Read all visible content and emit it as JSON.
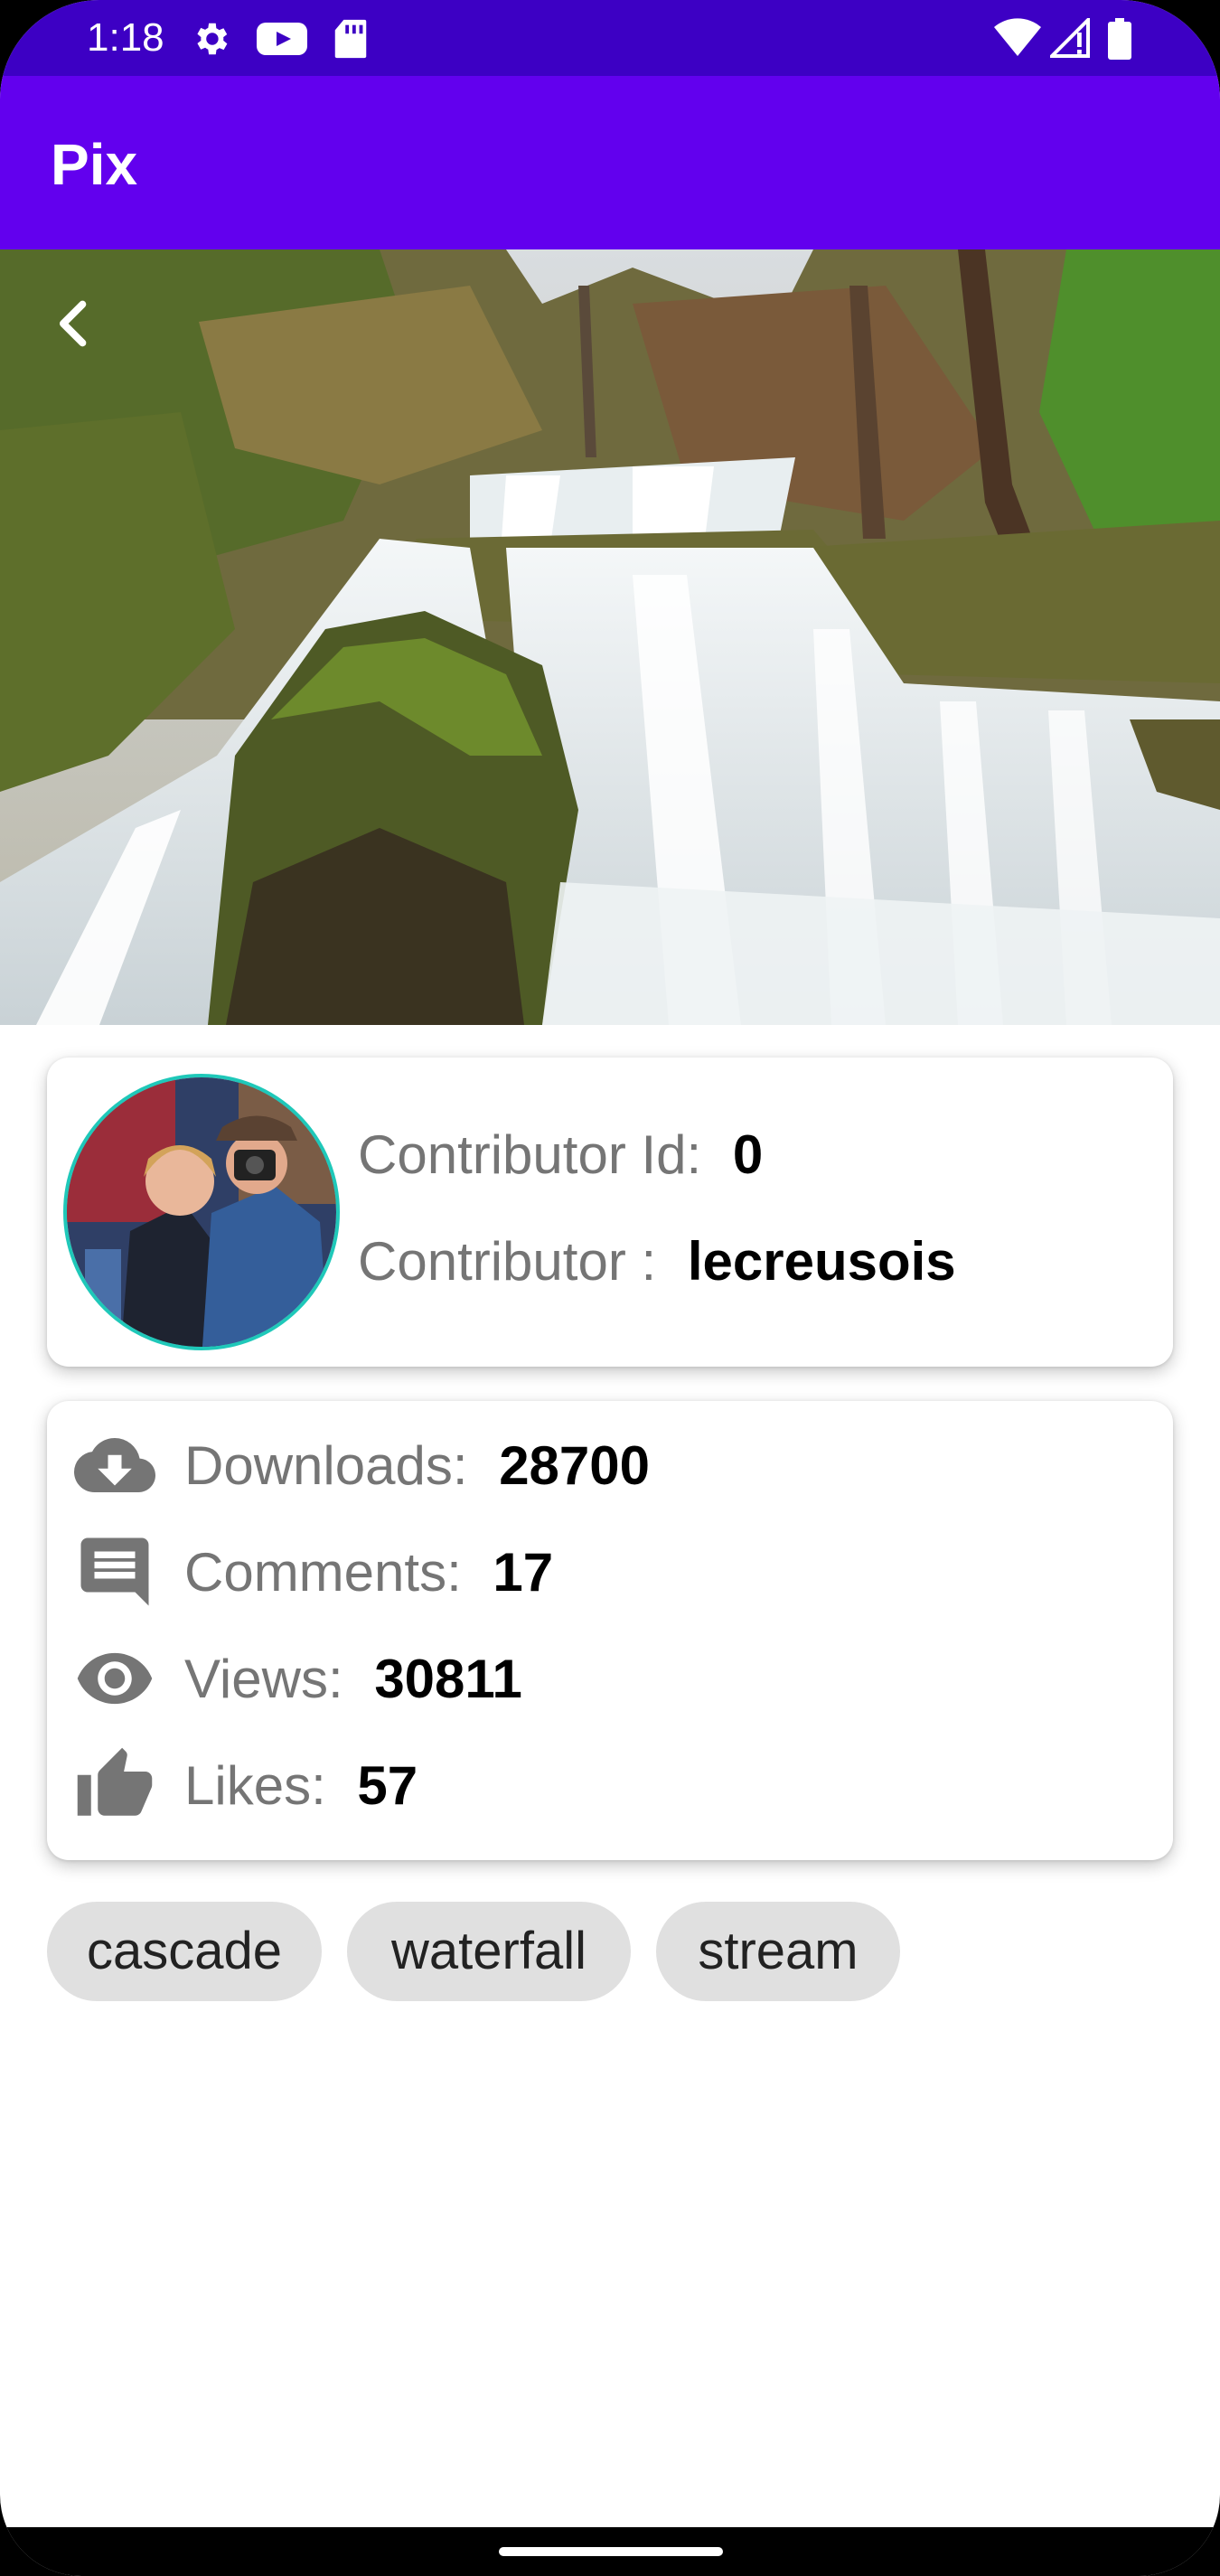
{
  "status_bar": {
    "time": "1:18",
    "icons": [
      "settings-icon",
      "youtube-icon",
      "sd-card-icon",
      "wifi-icon",
      "cell-signal-icon",
      "battery-icon"
    ]
  },
  "app_bar": {
    "title": "Pix"
  },
  "hero": {
    "description_icon": "back-arrow-icon"
  },
  "contributor": {
    "id_label": "Contributor Id:",
    "id_value": "0",
    "name_label": "Contributor :",
    "name_value": "lecreusois"
  },
  "stats": {
    "downloads_label": "Downloads:",
    "downloads_value": "28700",
    "comments_label": "Comments:",
    "comments_value": "17",
    "views_label": "Views:",
    "views_value": "30811",
    "likes_label": "Likes:",
    "likes_value": "57"
  },
  "tags": [
    "cascade",
    "waterfall",
    "stream"
  ],
  "colors": {
    "status_bar": "#3d00c4",
    "app_bar": "#6200ee",
    "avatar_ring": "#1fc8b9",
    "chip_bg": "#e0e0e0"
  }
}
